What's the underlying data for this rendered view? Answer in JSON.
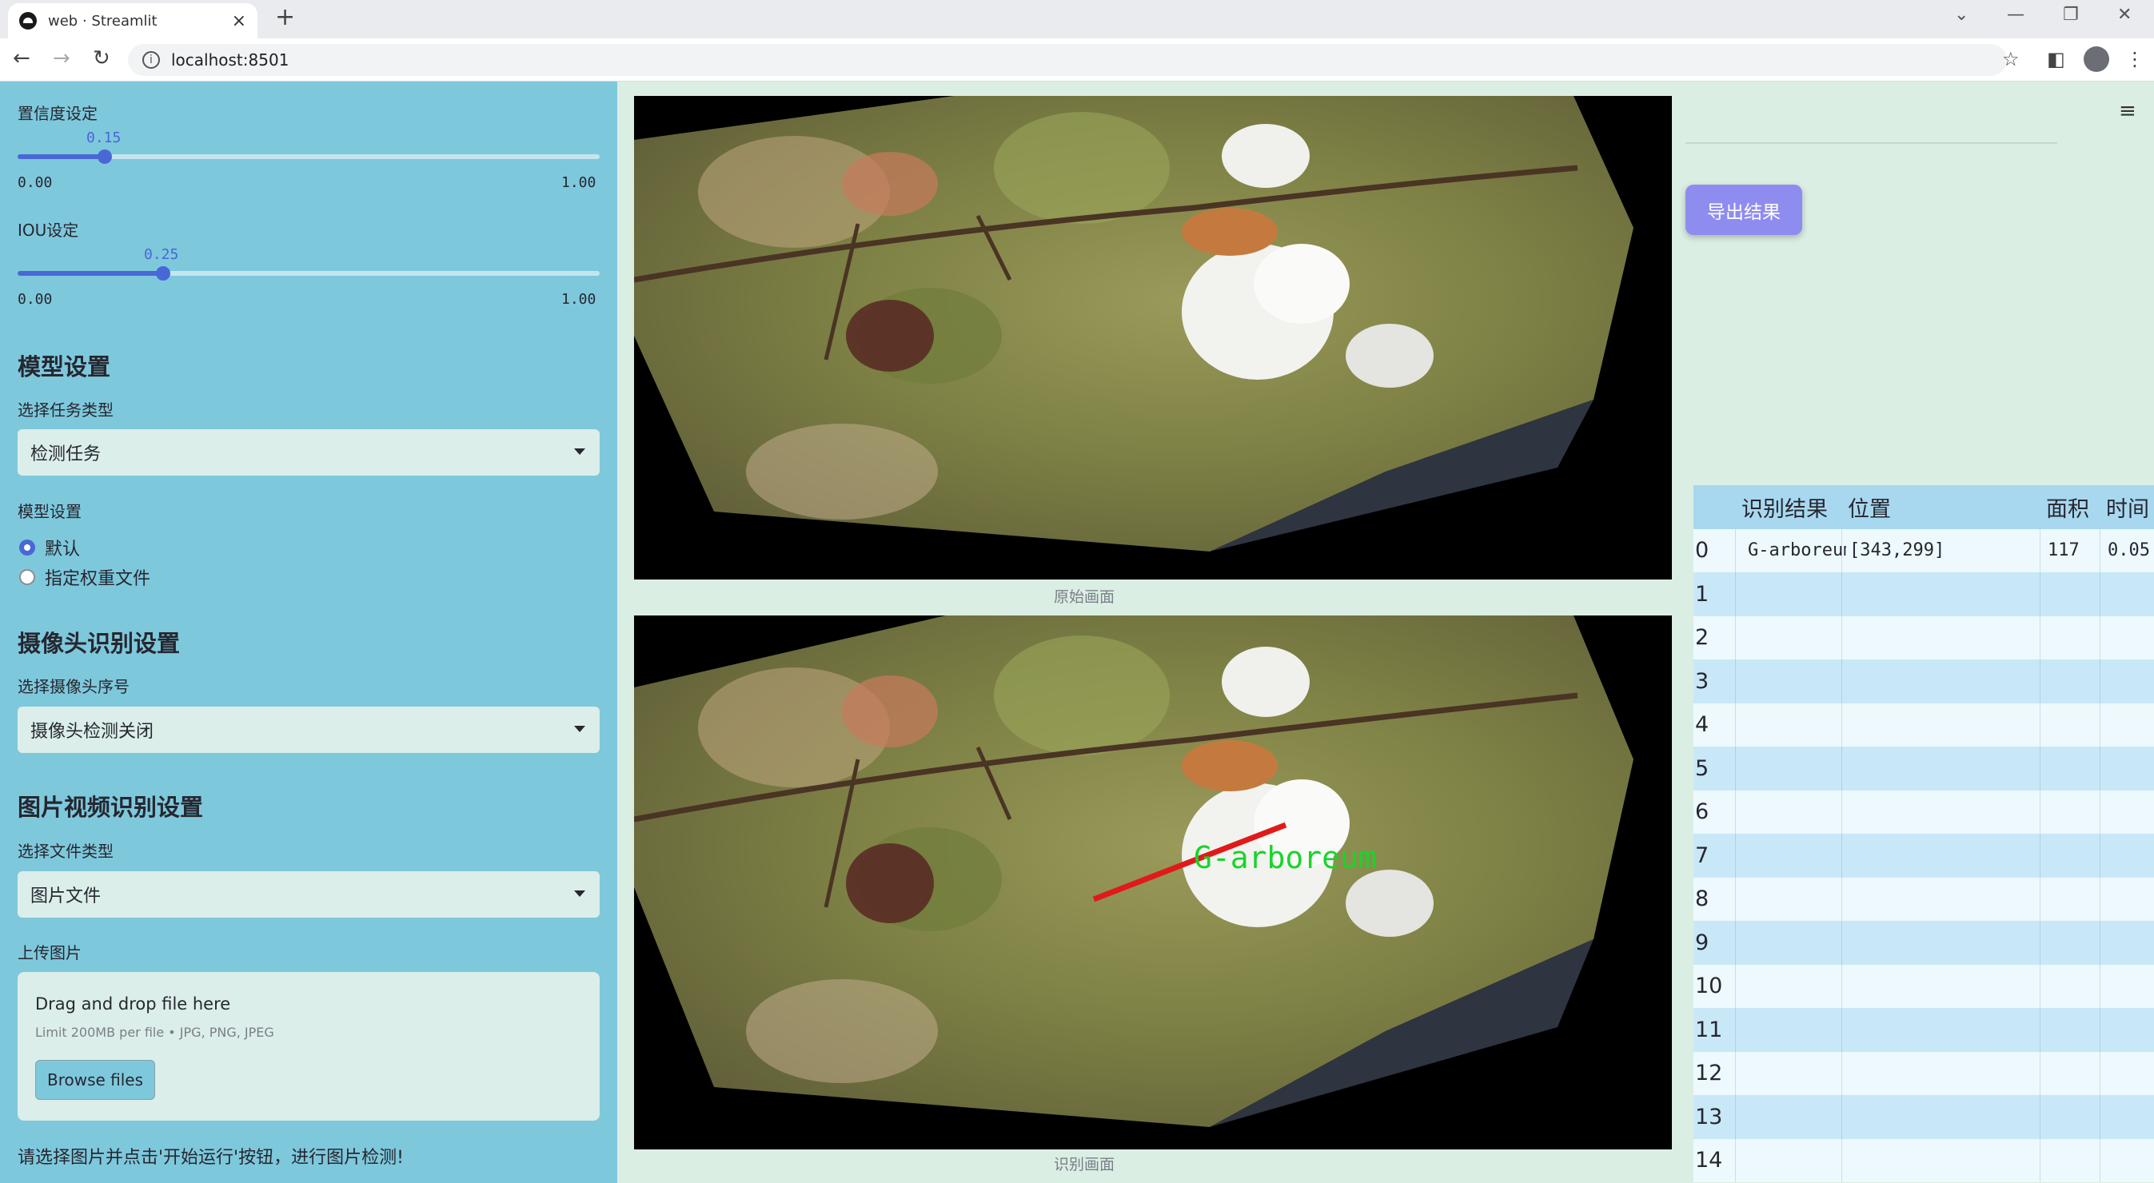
{
  "browser": {
    "tab_title": "web · Streamlit",
    "url": "localhost:8501"
  },
  "sidebar": {
    "confidence": {
      "label": "置信度设定",
      "value": "0.15",
      "min": "0.00",
      "max": "1.00",
      "fraction": 0.15
    },
    "iou": {
      "label": "IOU设定",
      "value": "0.25",
      "min": "0.00",
      "max": "1.00",
      "fraction": 0.25
    },
    "model_section": {
      "title": "模型设置",
      "task_label": "选择任务类型",
      "task_value": "检测任务",
      "model_label": "模型设置",
      "options": [
        "默认",
        "指定权重文件"
      ],
      "selected_option": 0
    },
    "camera_section": {
      "title": "摄像头识别设置",
      "camera_label": "选择摄像头序号",
      "camera_value": "摄像头检测关闭"
    },
    "media_section": {
      "title": "图片视频识别设置",
      "file_type_label": "选择文件类型",
      "file_type_value": "图片文件",
      "upload_label": "上传图片",
      "upload_title": "Drag and drop file here",
      "upload_limit": "Limit 200MB per file • JPG, PNG, JPEG",
      "browse_label": "Browse files"
    },
    "hint": "请选择图片并点击'开始运行'按钮，进行图片检测!"
  },
  "main": {
    "original_caption": "原始画面",
    "result_caption": "识别画面",
    "detection_label": "G-arboreum",
    "export_label": "导出结果",
    "table": {
      "columns": [
        "",
        "识别结果",
        "位置",
        "面积",
        "时间"
      ],
      "rows": [
        [
          "0",
          "G-arboreum",
          "[343,299]",
          "117",
          "0.05"
        ],
        [
          "1",
          "",
          "",
          "",
          ""
        ],
        [
          "2",
          "",
          "",
          "",
          ""
        ],
        [
          "3",
          "",
          "",
          "",
          ""
        ],
        [
          "4",
          "",
          "",
          "",
          ""
        ],
        [
          "5",
          "",
          "",
          "",
          ""
        ],
        [
          "6",
          "",
          "",
          "",
          ""
        ],
        [
          "7",
          "",
          "",
          "",
          ""
        ],
        [
          "8",
          "",
          "",
          "",
          ""
        ],
        [
          "9",
          "",
          "",
          "",
          ""
        ],
        [
          "10",
          "",
          "",
          "",
          ""
        ],
        [
          "11",
          "",
          "",
          "",
          ""
        ],
        [
          "12",
          "",
          "",
          "",
          ""
        ],
        [
          "13",
          "",
          "",
          "",
          ""
        ],
        [
          "14",
          "",
          "",
          "",
          ""
        ]
      ]
    }
  },
  "colors": {
    "sidebar_bg": "#7ec8dc",
    "main_bg": "#dbeee3",
    "accent": "#4a67d6",
    "export_button": "#8f8cf0",
    "table_header": "#a8d8f0",
    "table_row_odd": "#c8e8f8",
    "table_row_even": "#eef9fd"
  }
}
